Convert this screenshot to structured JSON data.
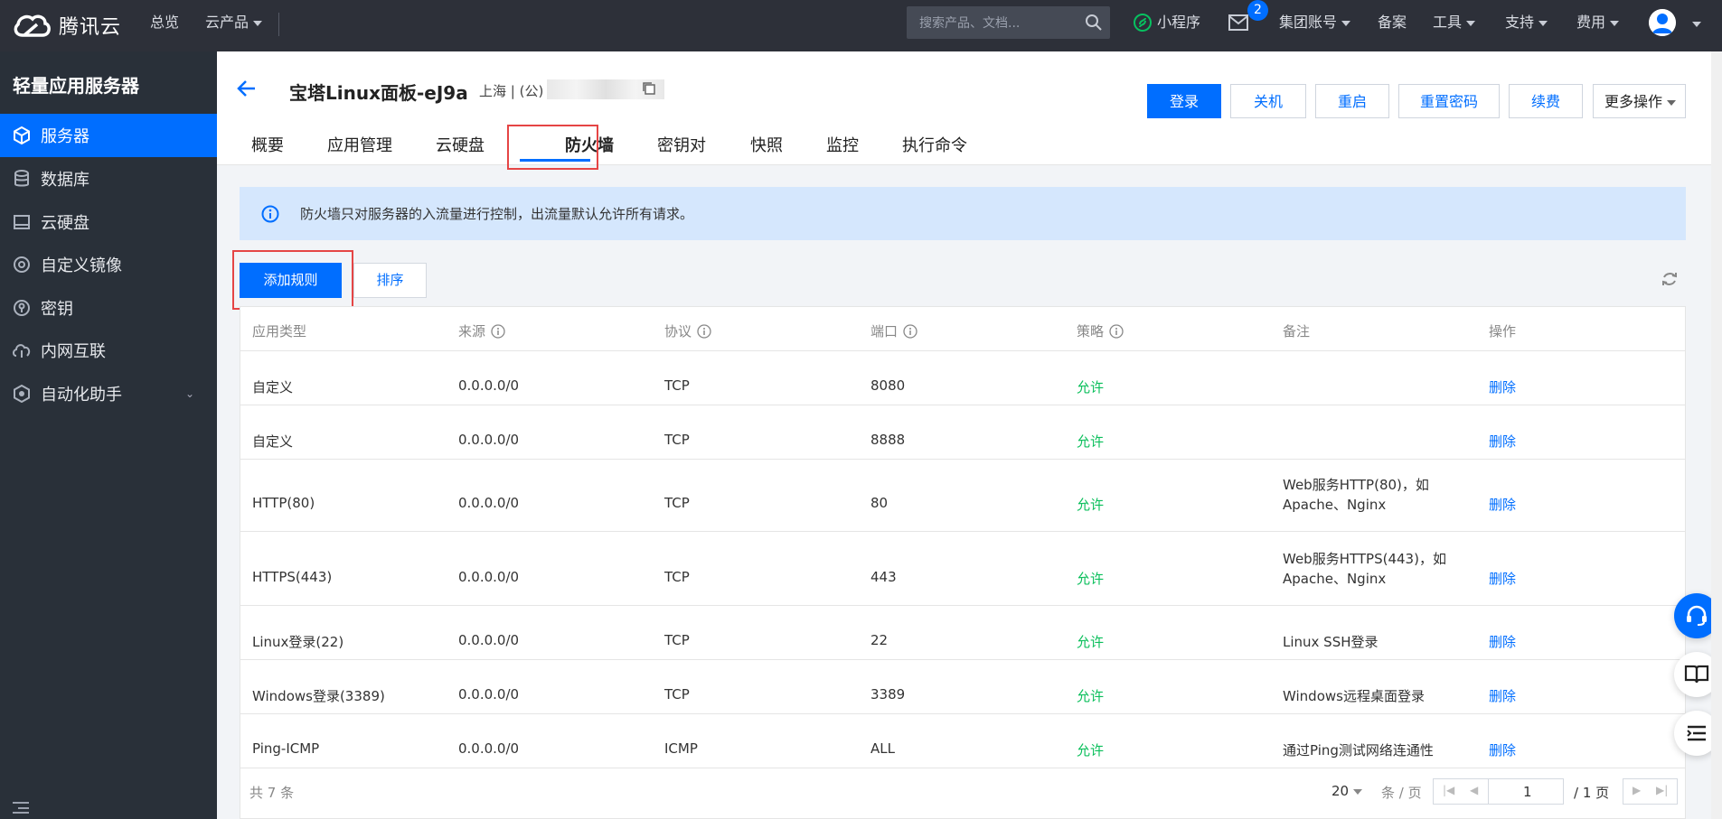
{
  "topbar": {
    "brand": "腾讯云",
    "overview": "总览",
    "products": "云产品",
    "search_placeholder": "搜索产品、文档...",
    "miniprogram": "小程序",
    "mail_badge": "2",
    "account": "集团账号",
    "record": "备案",
    "tools": "工具",
    "support": "支持",
    "fees": "费用"
  },
  "sidebar": {
    "title": "轻量应用服务器",
    "items": [
      {
        "label": "服务器",
        "icon": "cube-icon"
      },
      {
        "label": "数据库",
        "icon": "database-icon"
      },
      {
        "label": "云硬盘",
        "icon": "disk-icon"
      },
      {
        "label": "自定义镜像",
        "icon": "image-icon"
      },
      {
        "label": "密钥",
        "icon": "key-icon"
      },
      {
        "label": "内网互联",
        "icon": "network-icon"
      },
      {
        "label": "自动化助手",
        "icon": "automation-icon"
      }
    ]
  },
  "header": {
    "server_name": "宝塔Linux面板-eJ9a",
    "region": "上海 | (公) ",
    "buttons": {
      "login": "登录",
      "shutdown": "关机",
      "restart": "重启",
      "reset_password": "重置密码",
      "renew": "续费",
      "more": "更多操作"
    },
    "tabs": [
      "概要",
      "应用管理",
      "云硬盘",
      "防火墙",
      "密钥对",
      "快照",
      "监控",
      "执行命令"
    ],
    "active_tab": "防火墙"
  },
  "notice": "防火墙只对服务器的入流量进行控制，出流量默认允许所有请求。",
  "actions": {
    "add_rule": "添加规则",
    "sort": "排序"
  },
  "table": {
    "headers": [
      "应用类型",
      "来源",
      "协议",
      "端口",
      "策略",
      "备注",
      "操作"
    ],
    "rows": [
      {
        "type": "自定义",
        "source": "0.0.0.0/0",
        "protocol": "TCP",
        "port": "8080",
        "policy": "允许",
        "note1": "",
        "note2": "",
        "action": "删除"
      },
      {
        "type": "自定义",
        "source": "0.0.0.0/0",
        "protocol": "TCP",
        "port": "8888",
        "policy": "允许",
        "note1": "",
        "note2": "",
        "action": "删除"
      },
      {
        "type": "HTTP(80)",
        "source": "0.0.0.0/0",
        "protocol": "TCP",
        "port": "80",
        "policy": "允许",
        "note1": "Web服务HTTP(80)，如",
        "note2": "Apache、Nginx",
        "action": "删除"
      },
      {
        "type": "HTTPS(443)",
        "source": "0.0.0.0/0",
        "protocol": "TCP",
        "port": "443",
        "policy": "允许",
        "note1": "Web服务HTTPS(443)，如",
        "note2": "Apache、Nginx",
        "action": "删除"
      },
      {
        "type": "Linux登录(22)",
        "source": "0.0.0.0/0",
        "protocol": "TCP",
        "port": "22",
        "policy": "允许",
        "note1": "Linux SSH登录",
        "note2": "",
        "action": "删除"
      },
      {
        "type": "Windows登录(3389)",
        "source": "0.0.0.0/0",
        "protocol": "TCP",
        "port": "3389",
        "policy": "允许",
        "note1": "Windows远程桌面登录",
        "note2": "",
        "action": "删除"
      },
      {
        "type": "Ping-ICMP",
        "source": "0.0.0.0/0",
        "protocol": "ICMP",
        "port": "ALL",
        "policy": "允许",
        "note1": "通过Ping测试网络连通性",
        "note2": "",
        "action": "删除"
      }
    ]
  },
  "pagination": {
    "total": "共 7 条",
    "page_size": "20",
    "per_page": "条 / 页",
    "current_page": "1",
    "total_pages": "/ 1 页"
  },
  "colors": {
    "primary": "#006eff",
    "topbar": "#2d3039",
    "sidebar": "#293039",
    "allow": "#0abf5b",
    "highlight": "#e54545"
  }
}
